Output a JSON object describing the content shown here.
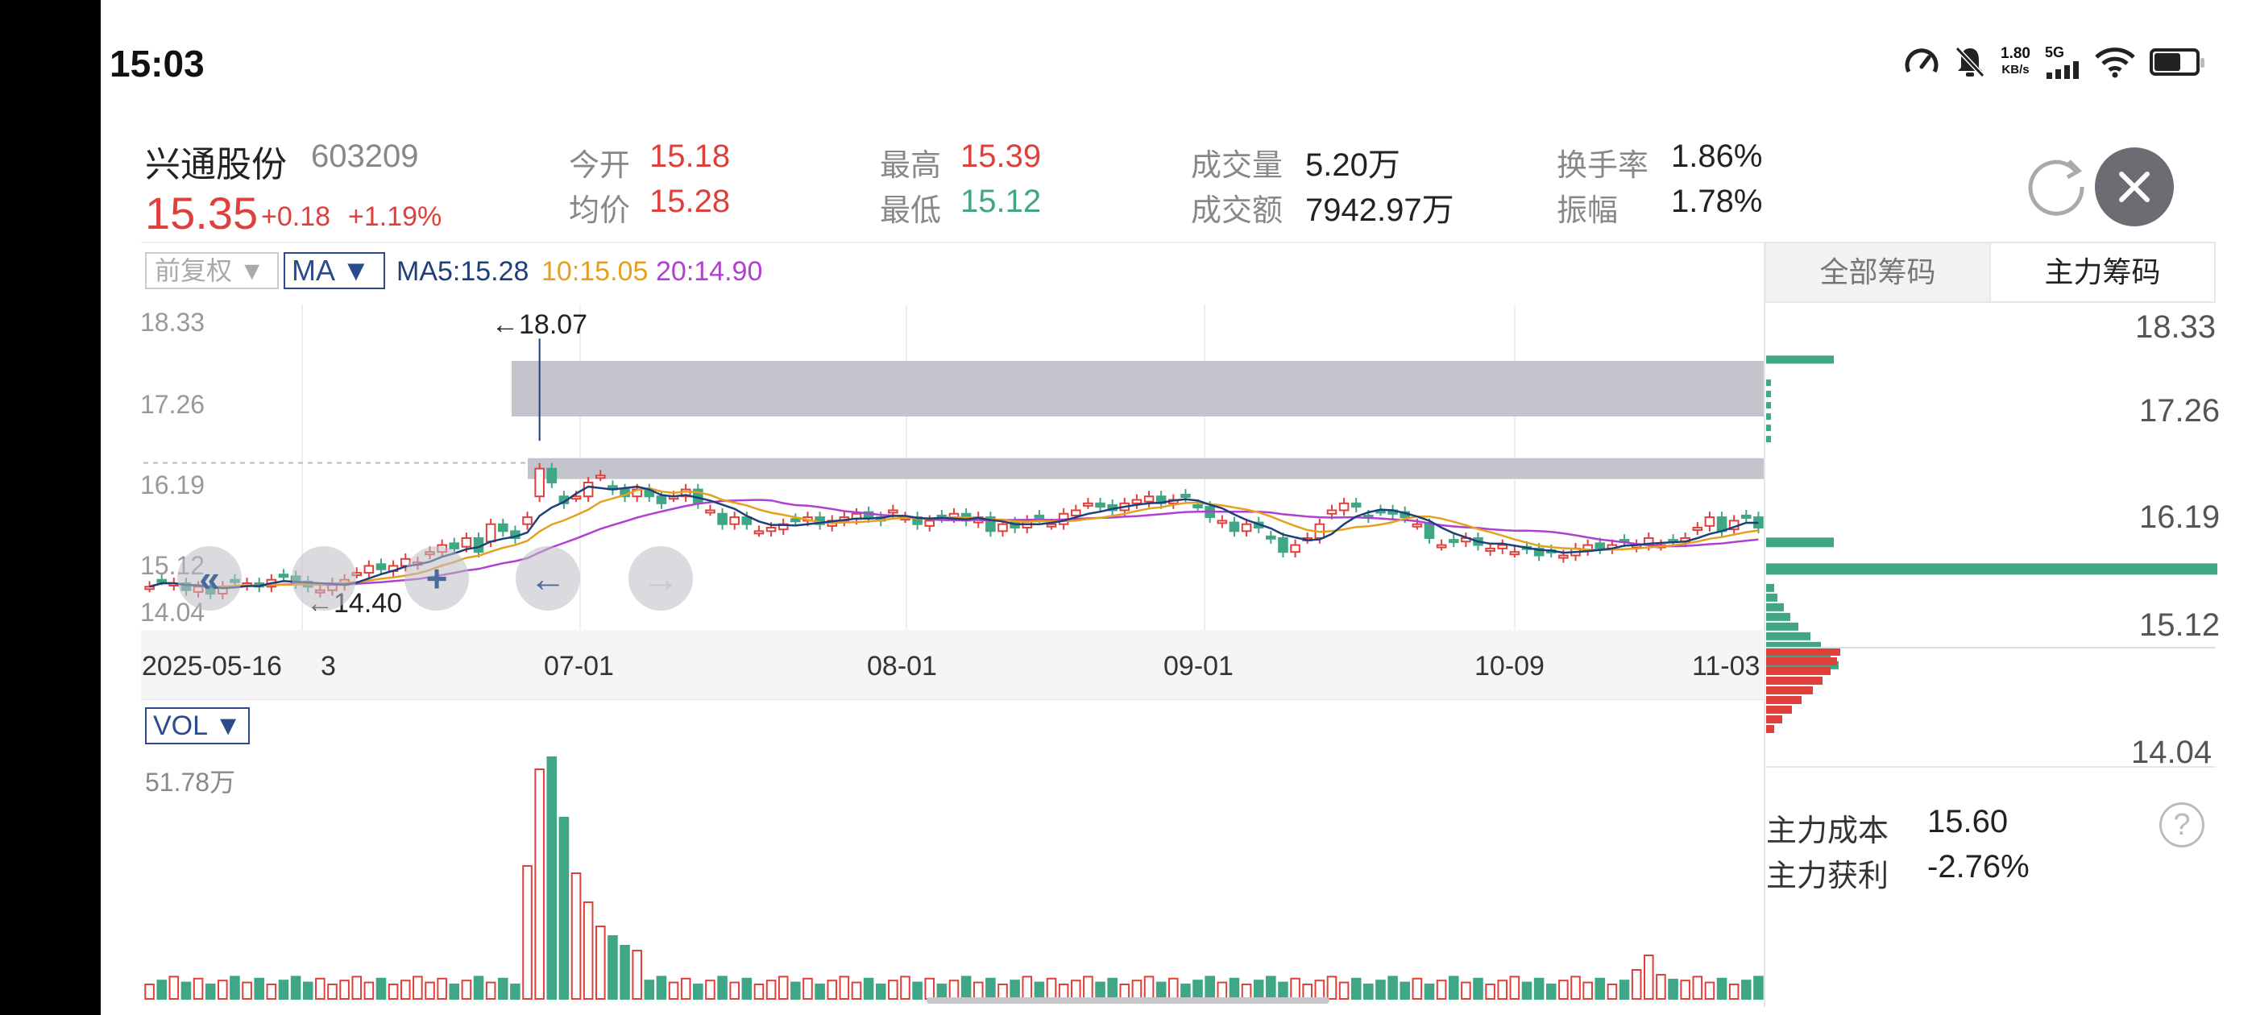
{
  "status_bar": {
    "time": "15:03",
    "net_speed_value": "1.80",
    "net_speed_unit": "KB/s",
    "network_type": "5G"
  },
  "stock": {
    "name": "兴通股份",
    "code": "603209",
    "price": "15.35",
    "change": "+0.18",
    "change_pct": "+1.19%"
  },
  "quote": {
    "open_label": "今开",
    "open_value": "15.18",
    "avg_label": "均价",
    "avg_value": "15.28",
    "high_label": "最高",
    "high_value": "15.39",
    "low_label": "最低",
    "low_value": "15.12",
    "volume_label": "成交量",
    "volume_value": "5.20万",
    "amount_label": "成交额",
    "amount_value": "7942.97万",
    "turnover_label": "换手率",
    "turnover_value": "1.86%",
    "amplitude_label": "振幅",
    "amplitude_value": "1.78%"
  },
  "toolbar": {
    "adjust_label": "前复权 ▼",
    "indicator_label": "MA ▼",
    "ma5": "MA5:15.28",
    "ma10": "10:15.05",
    "ma20": "20:14.90"
  },
  "tabs": {
    "all_chips": "全部筹码",
    "main_chips": "主力筹码"
  },
  "main_chart": {
    "y_ticks": [
      "18.33",
      "17.26",
      "16.19",
      "15.12",
      "14.04"
    ],
    "x_dates": [
      "2025-05-16",
      "07-01",
      "08-01",
      "09-01",
      "10-09",
      "11-03"
    ],
    "x_partial": "3",
    "high_marker": "←18.07",
    "low_marker": "←14.40"
  },
  "chip_chart": {
    "y_ticks": [
      "18.33",
      "17.26",
      "16.19",
      "15.12",
      "14.04"
    ]
  },
  "volume": {
    "indicator_label": "VOL ▼",
    "max_label": "51.78万"
  },
  "main_force": {
    "cost_label": "主力成本",
    "cost_value": "15.60",
    "profit_label": "主力获利",
    "profit_value": "-2.76%"
  },
  "icons": {
    "help": "?",
    "add": "+",
    "back": "←",
    "forward": "→",
    "rewind": "«"
  },
  "colors": {
    "up": "#e0403c",
    "down": "#3fa686",
    "ma5": "#1f3f7a",
    "ma10": "#e6a020",
    "ma20": "#b040d0",
    "chip_band": "#c3c4cc"
  },
  "chart_data": {
    "type": "candlestick",
    "x_range": [
      "2025-05-16",
      "2025-11-03"
    ],
    "ylim": [
      14.04,
      18.33
    ],
    "period_high": 18.07,
    "period_low": 14.4,
    "closes": [
      14.5,
      14.6,
      14.55,
      14.45,
      14.5,
      14.4,
      14.5,
      14.6,
      14.55,
      14.5,
      14.6,
      14.65,
      14.55,
      14.5,
      14.45,
      14.55,
      14.6,
      14.7,
      14.8,
      14.75,
      14.8,
      14.9,
      14.85,
      15.0,
      15.1,
      15.05,
      15.2,
      15.0,
      15.4,
      15.3,
      15.2,
      15.5,
      16.2,
      16.0,
      15.7,
      15.8,
      16.0,
      16.1,
      15.9,
      15.8,
      15.9,
      15.8,
      15.7,
      15.8,
      15.9,
      15.7,
      15.6,
      15.4,
      15.5,
      15.4,
      15.3,
      15.35,
      15.4,
      15.45,
      15.5,
      15.4,
      15.45,
      15.5,
      15.55,
      15.5,
      15.45,
      15.6,
      15.5,
      15.4,
      15.45,
      15.5,
      15.55,
      15.45,
      15.5,
      15.3,
      15.4,
      15.35,
      15.45,
      15.5,
      15.4,
      15.55,
      15.6,
      15.7,
      15.65,
      15.6,
      15.7,
      15.75,
      15.8,
      15.7,
      15.75,
      15.8,
      15.65,
      15.5,
      15.45,
      15.3,
      15.4,
      15.35,
      15.2,
      15.0,
      15.1,
      15.2,
      15.4,
      15.6,
      15.7,
      15.65,
      15.5,
      15.6,
      15.55,
      15.5,
      15.4,
      15.2,
      15.1,
      15.15,
      15.2,
      15.1,
      15.05,
      15.1,
      15.0,
      15.05,
      14.95,
      15.0,
      14.95,
      15.05,
      15.1,
      15.05,
      15.1,
      15.15,
      15.1,
      15.2,
      15.1,
      15.15,
      15.2,
      15.35,
      15.5,
      15.3,
      15.45,
      15.5,
      15.35
    ],
    "main_cost": 15.6,
    "main_profit_pct": -2.76
  }
}
